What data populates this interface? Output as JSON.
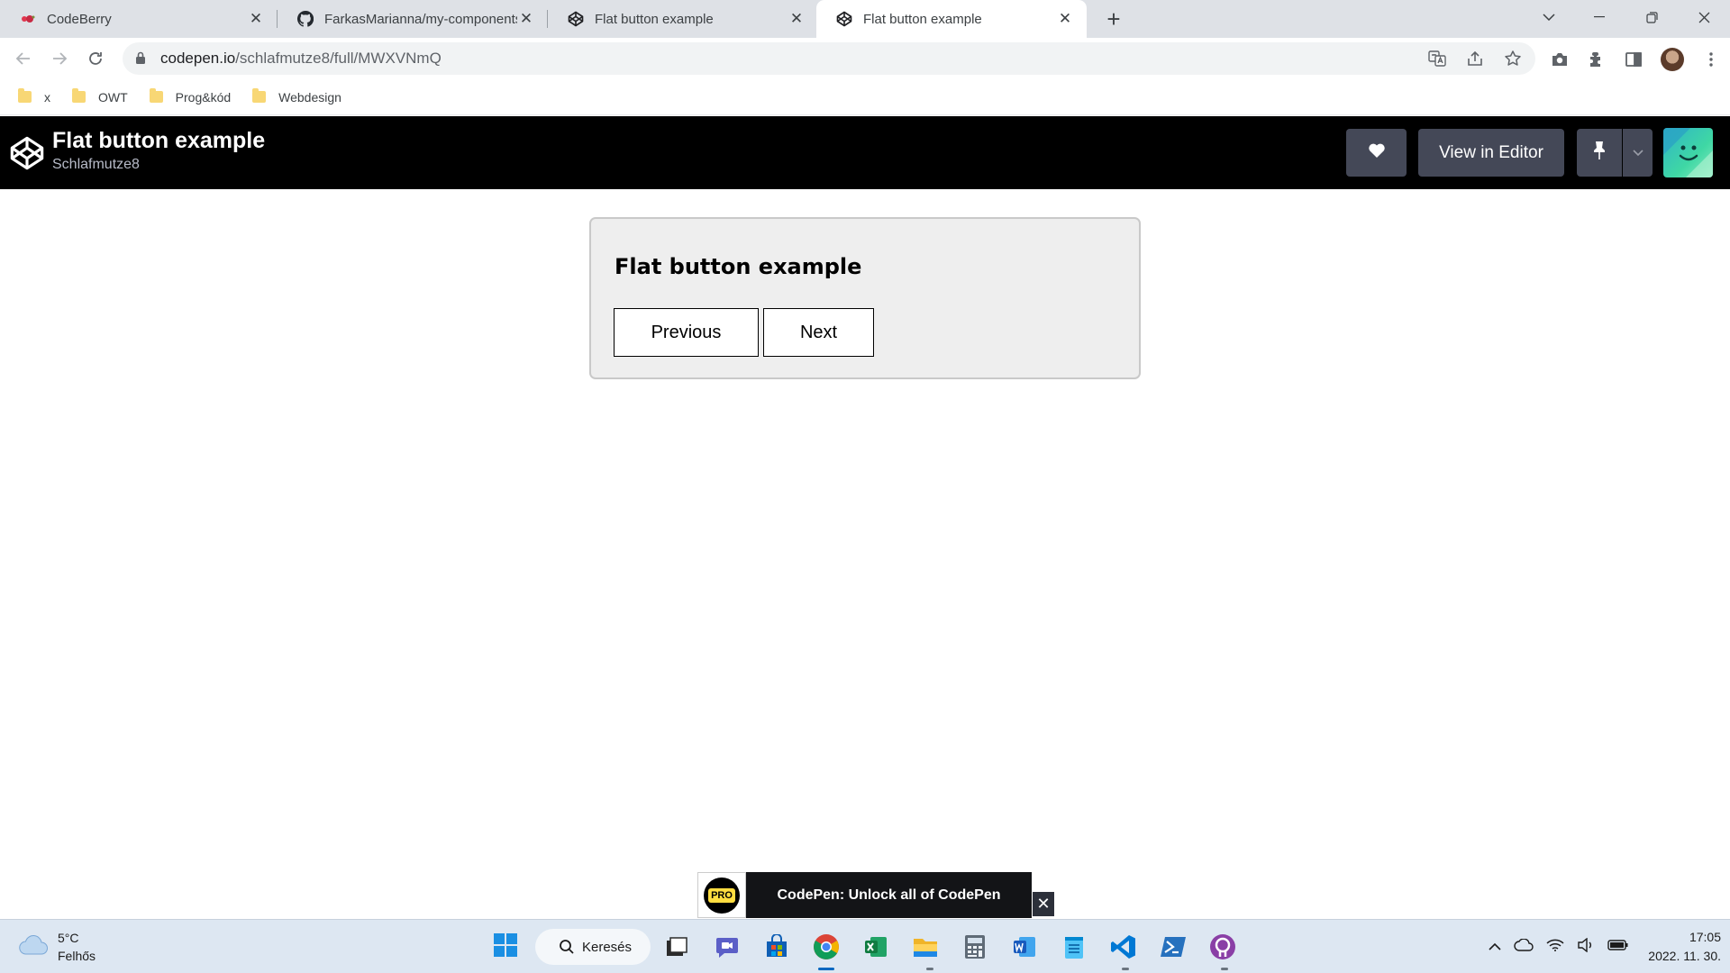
{
  "browser": {
    "tabs": [
      {
        "title": "CodeBerry",
        "favicon": "codeberry-icon",
        "active": false
      },
      {
        "title": "FarkasMarianna/my-components",
        "favicon": "github-icon",
        "active": false
      },
      {
        "title": "Flat button example",
        "favicon": "codepen-icon",
        "active": false
      },
      {
        "title": "Flat button example",
        "favicon": "codepen-icon",
        "active": true
      }
    ],
    "url_host": "codepen.io",
    "url_path": "/schlafmutze8/full/MWXVNmQ",
    "bookmarks": [
      {
        "label": "x"
      },
      {
        "label": "OWT"
      },
      {
        "label": "Prog&kód"
      },
      {
        "label": "Webdesign"
      }
    ]
  },
  "codepen": {
    "pen_title": "Flat button example",
    "author": "Schlafmutze8",
    "view_in_editor_label": "View in Editor",
    "header_color": "#000000",
    "button_color": "#444857"
  },
  "pen": {
    "heading": "Flat button example",
    "buttons": [
      {
        "label": "Previous"
      },
      {
        "label": "Next"
      }
    ]
  },
  "pro_banner": {
    "badge": "PRO",
    "text": "CodePen: Unlock all of CodePen",
    "close": "✕"
  },
  "taskbar": {
    "weather_temp": "5°C",
    "weather_desc": "Felhős",
    "search_label": "Keresés",
    "time": "17:05",
    "date": "2022. 11. 30.",
    "accent": "#0067c0"
  }
}
